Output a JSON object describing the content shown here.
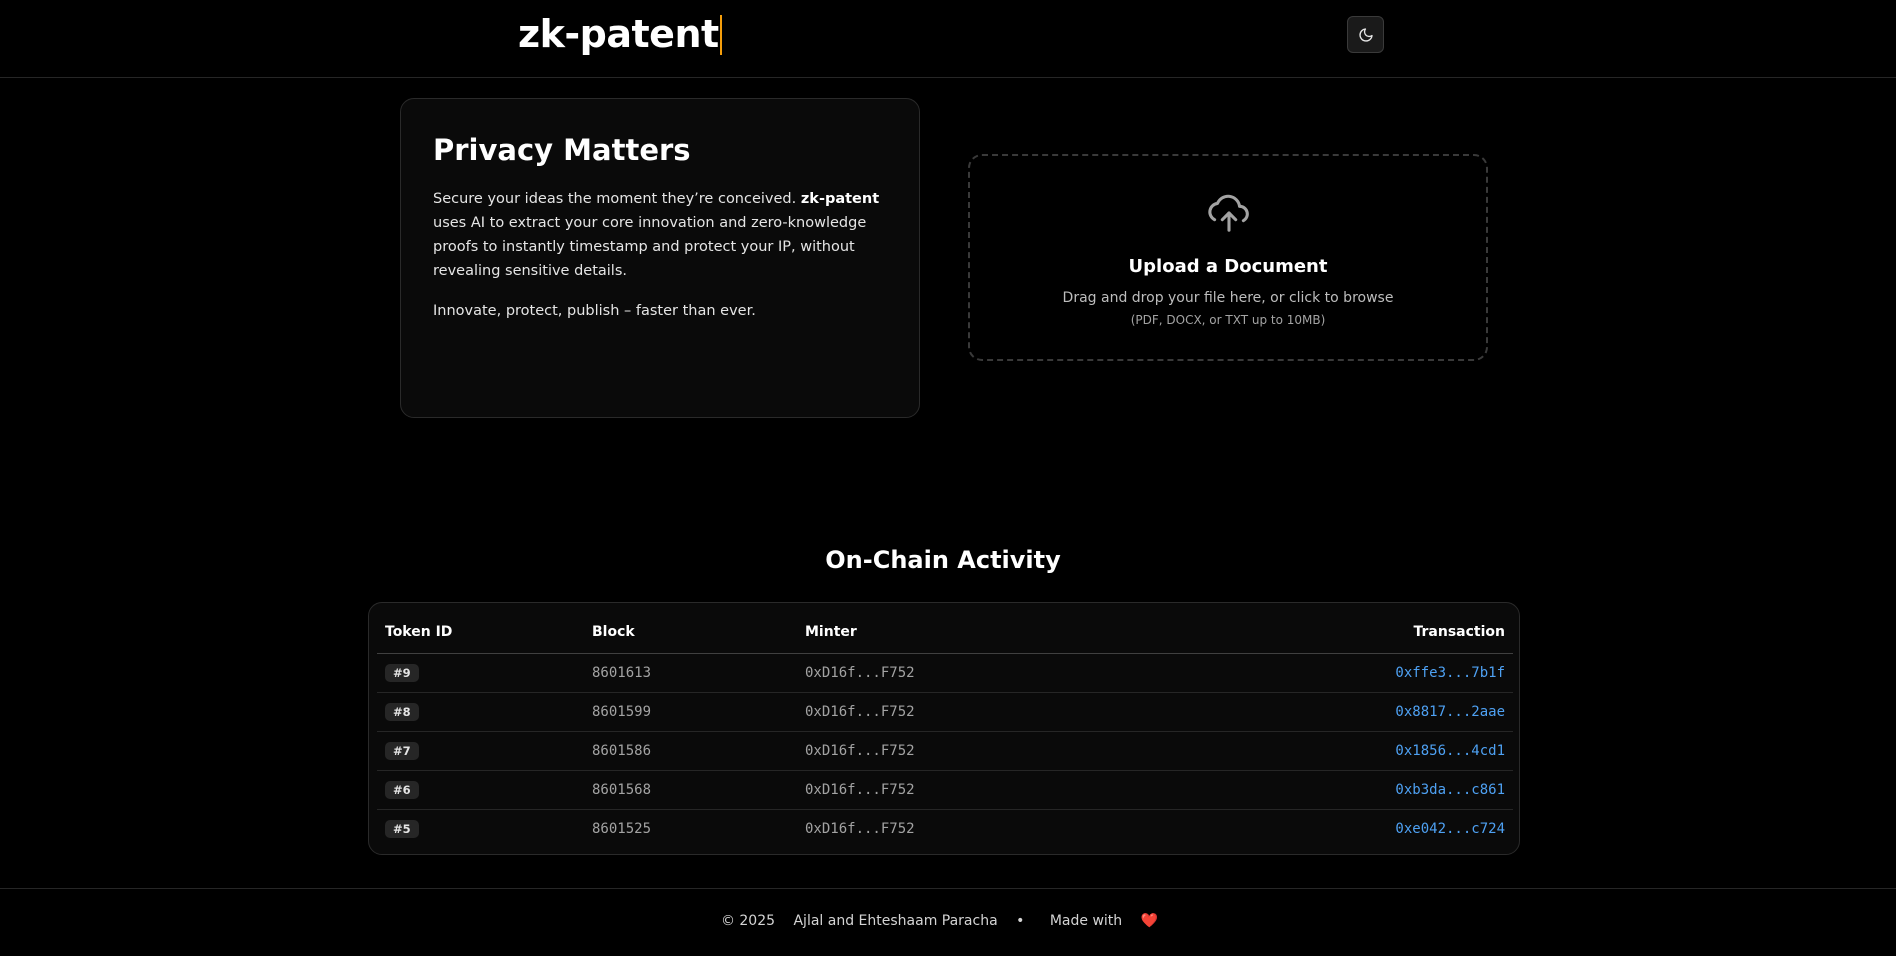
{
  "header": {
    "brand": "zk-patent",
    "theme_toggle_icon": "moon-icon"
  },
  "intro": {
    "title": "Privacy Matters",
    "paragraph1_before": "Secure your ideas the moment they’re conceived. ",
    "paragraph1_brand": "zk-patent",
    "paragraph1_after": " uses AI to extract your core innovation and zero-knowledge proofs to instantly timestamp and protect your IP, without revealing sensitive details.",
    "paragraph2": "Innovate, protect, publish – faster than ever."
  },
  "upload": {
    "icon": "cloud-upload-icon",
    "title": "Upload a Document",
    "subtitle": "Drag and drop your file here, or click to browse",
    "hint": "(PDF, DOCX, or TXT up to 10MB)"
  },
  "activity": {
    "title": "On-Chain Activity",
    "columns": [
      "Token ID",
      "Block",
      "Minter",
      "Transaction"
    ],
    "rows": [
      {
        "token": "#9",
        "block": "8601613",
        "minter": "0xD16f...F752",
        "tx": "0xffe3...7b1f"
      },
      {
        "token": "#8",
        "block": "8601599",
        "minter": "0xD16f...F752",
        "tx": "0x8817...2aae"
      },
      {
        "token": "#7",
        "block": "8601586",
        "minter": "0xD16f...F752",
        "tx": "0x1856...4cd1"
      },
      {
        "token": "#6",
        "block": "8601568",
        "minter": "0xD16f...F752",
        "tx": "0xb3da...c861"
      },
      {
        "token": "#5",
        "block": "8601525",
        "minter": "0xD16f...F752",
        "tx": "0xe042...c724"
      }
    ]
  },
  "footer": {
    "copyright": "© 2025",
    "authors": "Ajlal and Ehteshaam Paracha",
    "separator": "•",
    "made_with": "Made with",
    "heart": "❤️"
  },
  "colors": {
    "background": "#000000",
    "link": "#4ea1f3",
    "caret": "#f59e0b"
  }
}
